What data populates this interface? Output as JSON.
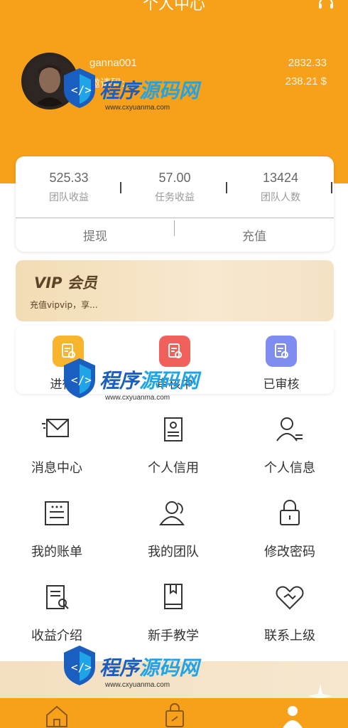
{
  "header": {
    "title": "个人中心"
  },
  "profile": {
    "username": "ganna001",
    "invite_label": "邀请码:",
    "balance_primary": "2832.33",
    "balance_usd": "238.21 $"
  },
  "stats": [
    {
      "value": "525.33",
      "label": "团队收益"
    },
    {
      "value": "57.00",
      "label": "任务收益"
    },
    {
      "value": "13424",
      "label": "团队人数"
    }
  ],
  "actions": {
    "withdraw": "提现",
    "recharge": "充值"
  },
  "vip": {
    "title": "VIP 会员",
    "subtitle": "充值vipvip，享..."
  },
  "status": [
    {
      "label": "进行中",
      "color": "#f7b42c"
    },
    {
      "label": "审核中",
      "color": "#f0615b"
    },
    {
      "label": "已审核",
      "color": "#7f8df0"
    }
  ],
  "menu": [
    {
      "label": "消息中心",
      "icon": "envelope-icon"
    },
    {
      "label": "个人信用",
      "icon": "certificate-icon"
    },
    {
      "label": "个人信息",
      "icon": "user-info-icon"
    },
    {
      "label": "我的账单",
      "icon": "bill-icon"
    },
    {
      "label": "我的团队",
      "icon": "team-icon"
    },
    {
      "label": "修改密码",
      "icon": "lock-icon"
    },
    {
      "label": "收益介绍",
      "icon": "document-icon"
    },
    {
      "label": "新手教学",
      "icon": "book-icon"
    },
    {
      "label": "联系上级",
      "icon": "handshake-icon"
    }
  ],
  "watermark": {
    "text_a": "程序",
    "text_b": "源码网",
    "url": "www.cxyuanma.com"
  },
  "colors": {
    "brand": "#f7a01a",
    "vip_bg": "#f2dcb4"
  }
}
